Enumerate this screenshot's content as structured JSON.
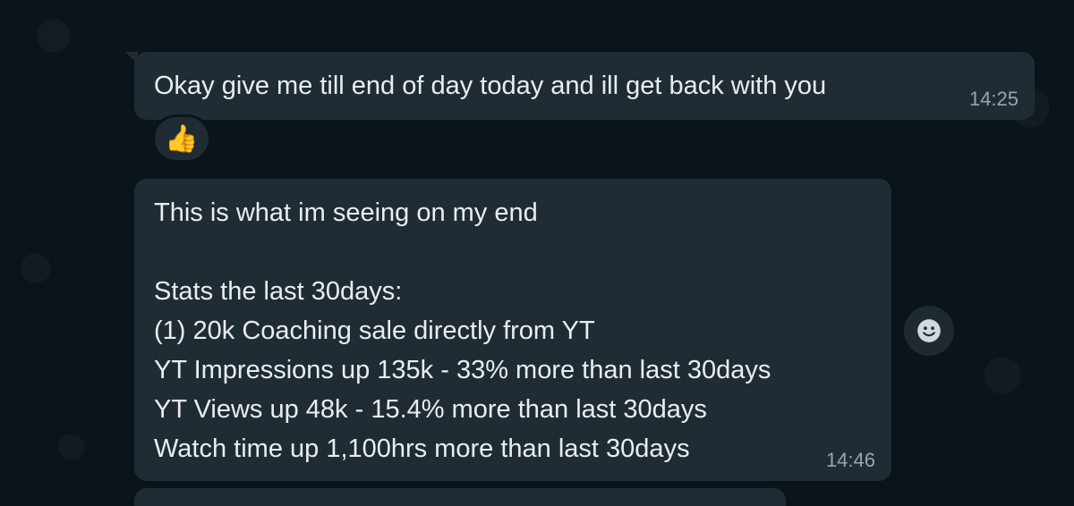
{
  "messages": [
    {
      "text": "Okay give me till end of day today and ill get back with you",
      "time": "14:25",
      "reaction": "👍"
    },
    {
      "text": "This is what im seeing on my end\n\nStats the last 30days:\n(1) 20k Coaching sale directly from YT\nYT Impressions up 135k - 33% more than last 30days\nYT Views up 48k - 15.4% more than last 30days\nWatch time up 1,100hrs more than last 30days",
      "time": "14:46"
    }
  ],
  "icons": {
    "reaction_button": "smiley-icon"
  },
  "colors": {
    "background": "#0b141a",
    "bubble": "#202c33",
    "text": "#e9edef",
    "time": "#9aa5ab"
  }
}
